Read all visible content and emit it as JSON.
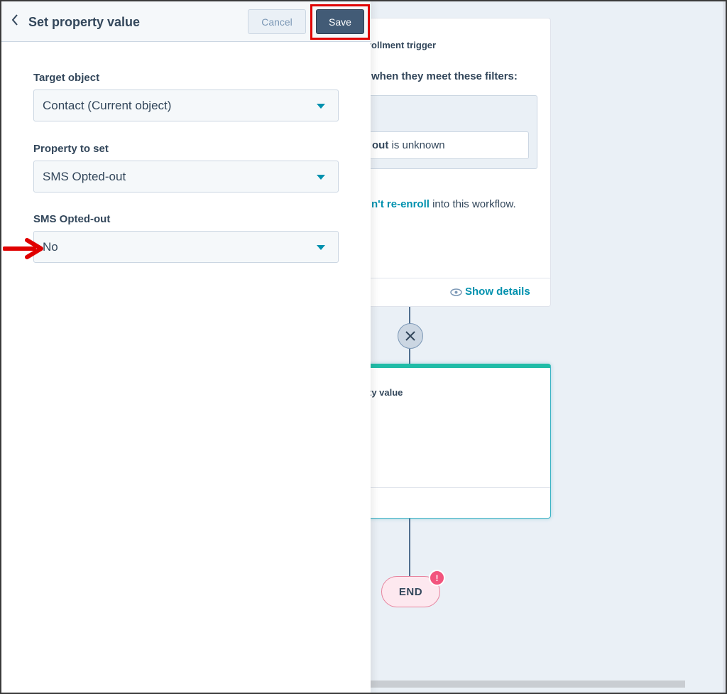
{
  "panel": {
    "title": "Set property value",
    "cancel_label": "Cancel",
    "save_label": "Save",
    "fields": [
      {
        "label": "Target object",
        "value": "Contact (Current object)"
      },
      {
        "label": "Property to set",
        "value": "SMS Opted-out"
      },
      {
        "label": "SMS Opted-out",
        "value": "No"
      }
    ]
  },
  "canvas": {
    "trigger": {
      "heading": "rollment trigger",
      "subheading": "when they meet these filters:",
      "filter_bold": "out",
      "filter_rest": " is unknown",
      "reenroll_link": "n't re-enroll",
      "reenroll_rest": " into this workflow.",
      "show_details": "Show details"
    },
    "action": {
      "title": "ty value"
    },
    "end_label": "END",
    "end_badge": "!"
  },
  "colors": {
    "accent": "#0091ae",
    "save": "#425b76",
    "highlight": "#e00000",
    "action_bar": "#1fbca7",
    "alert": "#f2547d"
  }
}
